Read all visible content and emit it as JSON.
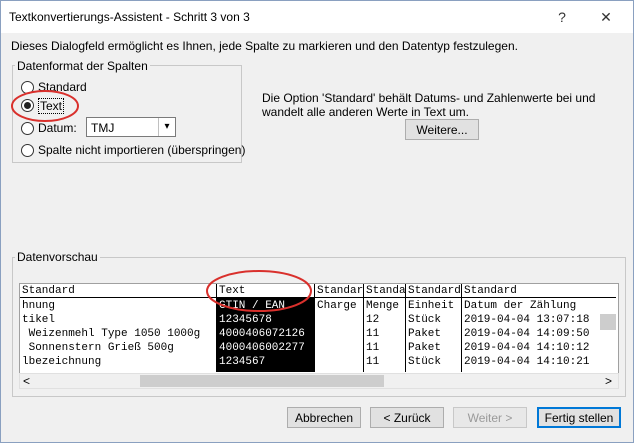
{
  "dialog": {
    "title": "Textkonvertierungs-Assistent - Schritt 3 von 3",
    "help_glyph": "?",
    "close_glyph": "✕",
    "description": "Dieses Dialogfeld ermöglicht es Ihnen, jede Spalte zu markieren und den Datentyp festzulegen."
  },
  "format_group": {
    "legend": "Datenformat der Spalten",
    "options": [
      {
        "label": "Standard",
        "selected": false
      },
      {
        "label": "Text",
        "selected": true
      },
      {
        "label": "Datum:",
        "selected": false
      },
      {
        "label": "Spalte nicht importieren (überspringen)",
        "selected": false
      }
    ],
    "date_format_value": "TMJ"
  },
  "info": {
    "line1": "Die Option 'Standard' behält Datums- und Zahlenwerte bei und",
    "line2": "wandelt alle anderen Werte in Text um.",
    "more_button": "Weitere..."
  },
  "preview": {
    "legend": "Datenvorschau",
    "headers": [
      "Standard",
      "Text",
      "Standard",
      "Standard",
      "Standard",
      "Standard"
    ],
    "rows": [
      [
        "hnung",
        "GTIN / EAN",
        "Charge",
        "Menge",
        "Einheit",
        "Datum der Zählung"
      ],
      [
        "tikel",
        "12345678",
        "",
        "12",
        "Stück",
        "2019-04-04 13:07:18"
      ],
      [
        " Weizenmehl Type 1050 1000g",
        "4000406072126",
        "",
        "11",
        "Paket",
        "2019-04-04 14:09:50"
      ],
      [
        " Sonnenstern Grieß 500g",
        "4000406002277",
        "",
        "11",
        "Paket",
        "2019-04-04 14:10:12"
      ],
      [
        "lbezeichnung",
        "1234567",
        "",
        "11",
        "Stück",
        "2019-04-04 14:10:21"
      ]
    ],
    "scroll_left": "<",
    "scroll_right": ">"
  },
  "buttons": {
    "cancel": "Abbrechen",
    "back": "< Zurück",
    "next": "Weiter >",
    "finish": "Fertig stellen"
  },
  "colors": {
    "annotation": "#d9302c",
    "accent": "#0078d7"
  }
}
